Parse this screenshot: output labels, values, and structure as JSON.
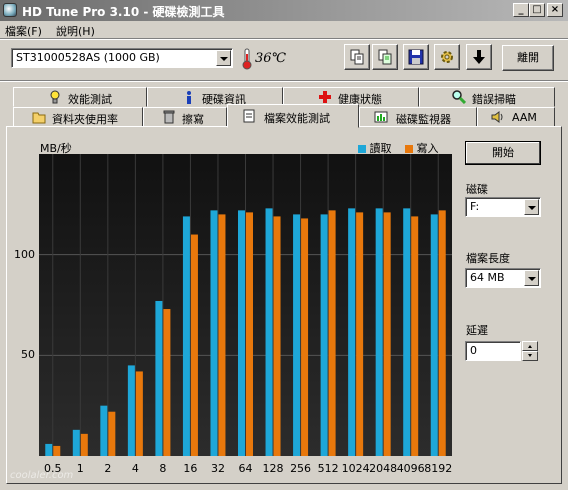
{
  "window": {
    "title": "HD Tune Pro 3.10 - 硬碟檢測工具"
  },
  "menu": [
    "檔案(F)",
    "說明(H)"
  ],
  "toolbar": {
    "drive": "ST31000528AS (1000 GB)",
    "temperature": "36℃",
    "exit_label": "離開"
  },
  "tabs_row1": [
    {
      "label": "效能測試",
      "icon": "lightbulb-icon"
    },
    {
      "label": "硬碟資訊",
      "icon": "info-icon"
    },
    {
      "label": "健康狀態",
      "icon": "red-cross-icon"
    },
    {
      "label": "錯誤掃瞄",
      "icon": "magnifier-icon"
    }
  ],
  "tabs_row2": [
    {
      "label": "資料夾使用率",
      "icon": "folder-icon"
    },
    {
      "label": "擦寫",
      "icon": "trash-icon"
    },
    {
      "label": "檔案效能測試",
      "icon": "document-icon",
      "active": true
    },
    {
      "label": "磁碟監視器",
      "icon": "monitor-icon"
    },
    {
      "label": "AAM",
      "icon": "speaker-icon"
    }
  ],
  "side": {
    "start_label": "開始",
    "disk_label": "磁碟",
    "disk_value": "F:",
    "file_length_label": "檔案長度",
    "file_length_value": "64 MB",
    "delay_label": "延遲",
    "delay_value": "0"
  },
  "watermark": "coolaler.com",
  "chart_data": {
    "type": "bar",
    "ylabel": "MB/秒",
    "ylim": [
      0,
      150
    ],
    "yticks": [
      50,
      100
    ],
    "categories": [
      "0.5",
      "1",
      "2",
      "4",
      "8",
      "16",
      "32",
      "64",
      "128",
      "256",
      "512",
      "1024",
      "2048",
      "4096",
      "8192"
    ],
    "series": [
      {
        "name": "讀取",
        "color": "#1ea7d8",
        "values": [
          6,
          13,
          25,
          45,
          77,
          119,
          122,
          122,
          123,
          120,
          120,
          123,
          123,
          123,
          120
        ]
      },
      {
        "name": "寫入",
        "color": "#e8780c",
        "values": [
          5,
          11,
          22,
          42,
          73,
          110,
          120,
          121,
          119,
          118,
          122,
          121,
          121,
          119,
          122
        ]
      }
    ]
  }
}
